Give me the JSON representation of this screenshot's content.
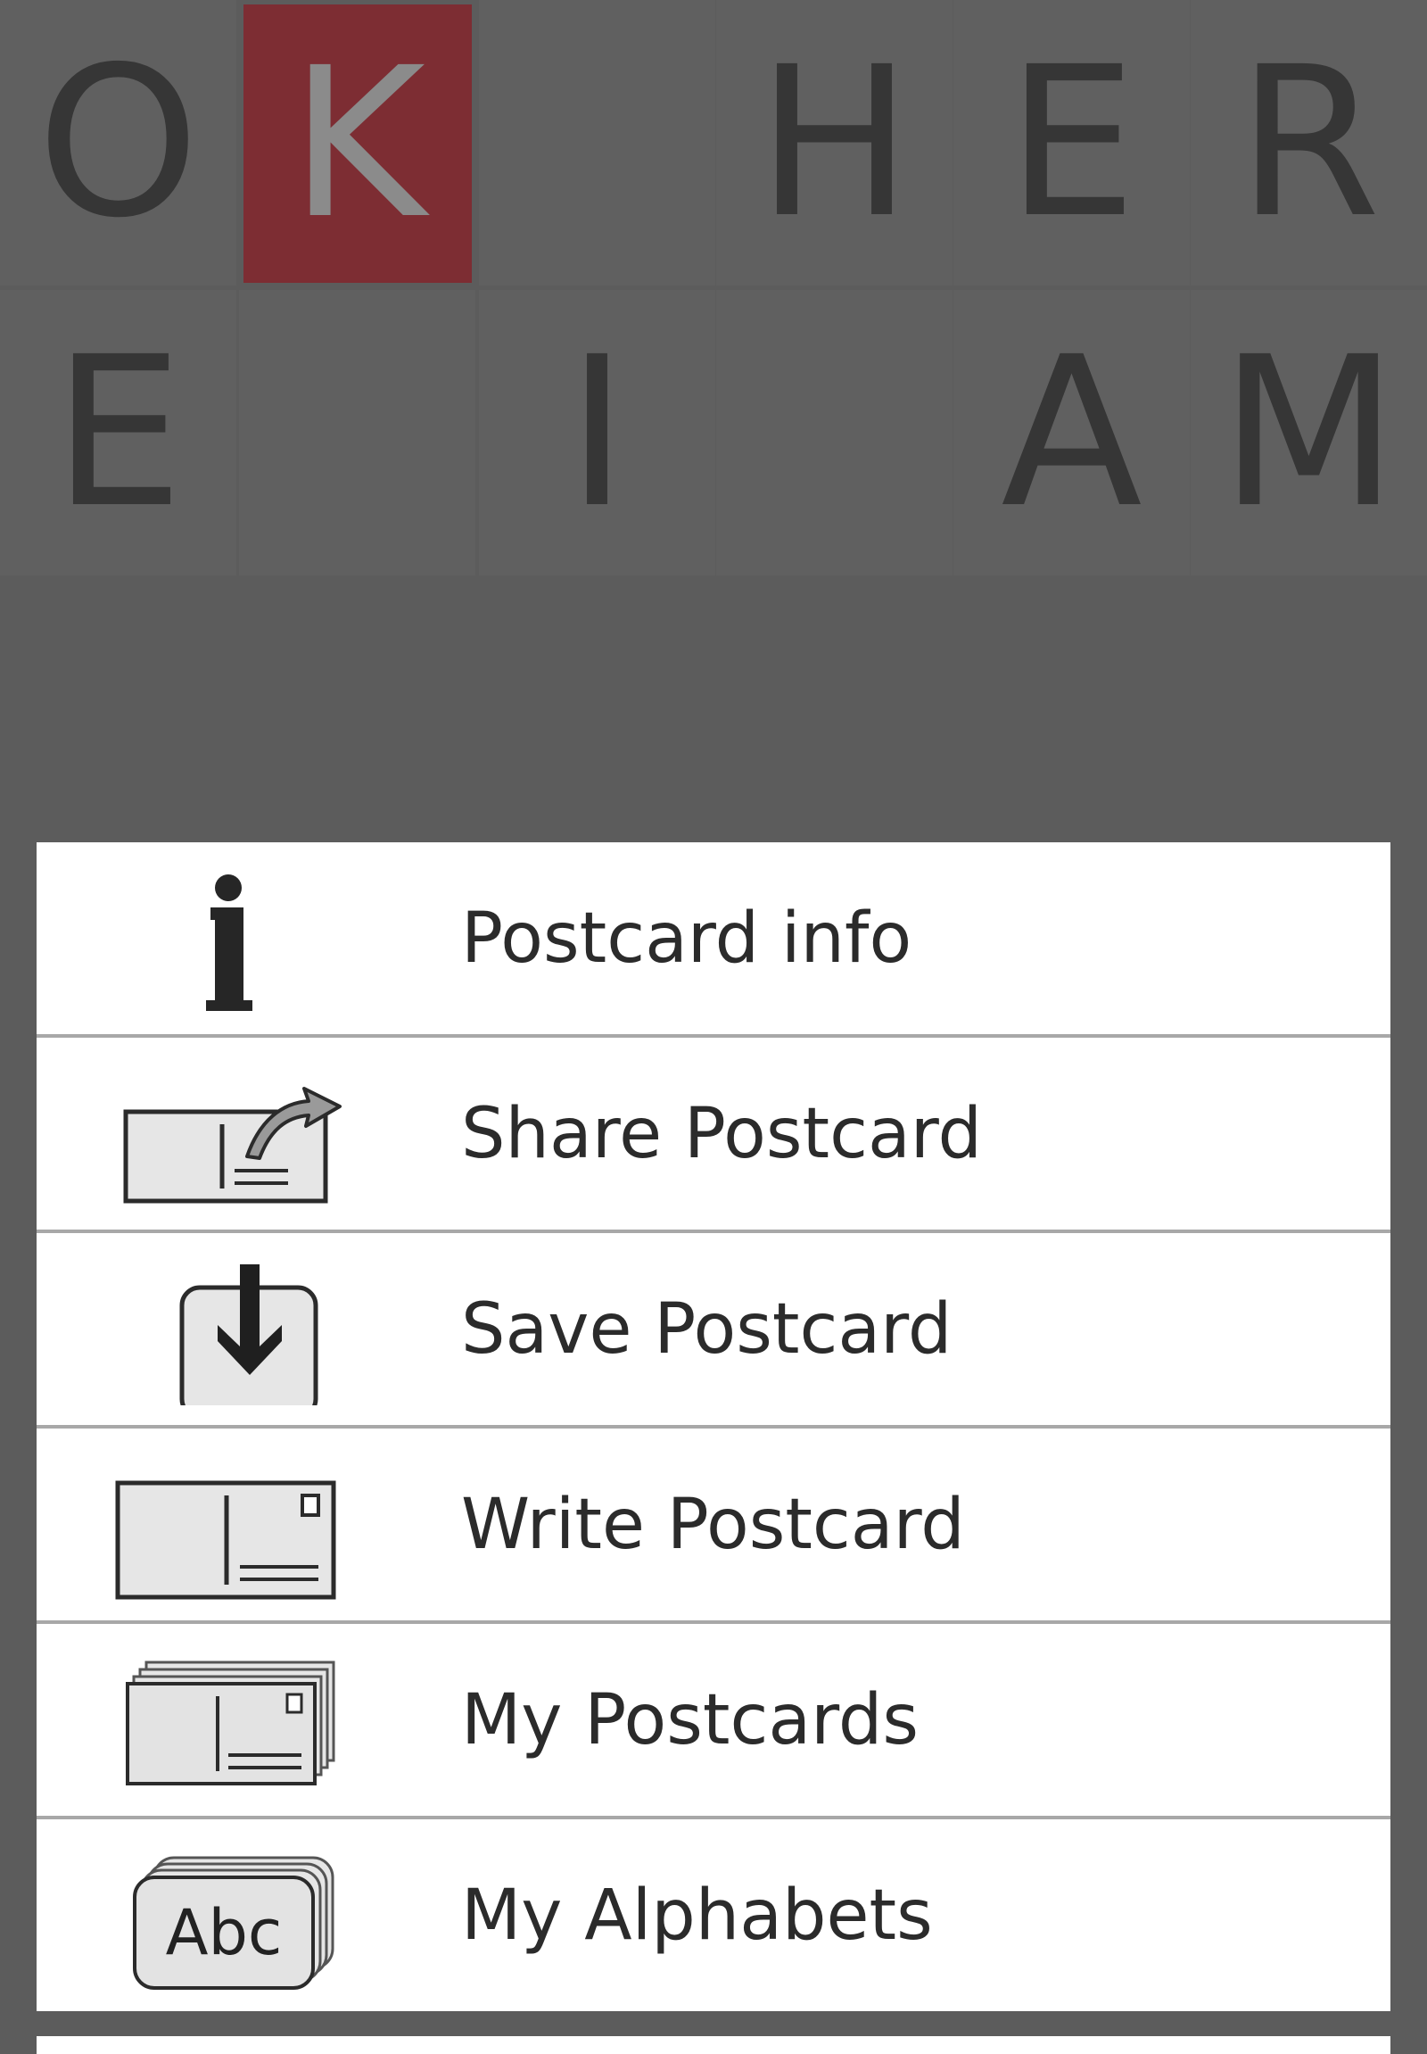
{
  "background_color": "#5c5c5c",
  "highlight_color": "#7d2d33",
  "letters": {
    "row1": [
      "O",
      "K",
      "",
      "H",
      "E",
      "R"
    ],
    "row2": [
      "E",
      "",
      "I",
      "",
      "A",
      "M"
    ],
    "highlighted": "K"
  },
  "menu": {
    "items": [
      {
        "label": "Postcard info",
        "icon": "info-icon"
      },
      {
        "label": "Share Postcard",
        "icon": "share-postcard-icon"
      },
      {
        "label": "Save Postcard",
        "icon": "save-postcard-icon"
      },
      {
        "label": "Write Postcard",
        "icon": "write-postcard-icon"
      },
      {
        "label": "My Postcards",
        "icon": "my-postcards-icon"
      },
      {
        "label": "My Alphabets",
        "icon": "my-alphabets-icon",
        "icon_text": "Abc"
      }
    ]
  }
}
